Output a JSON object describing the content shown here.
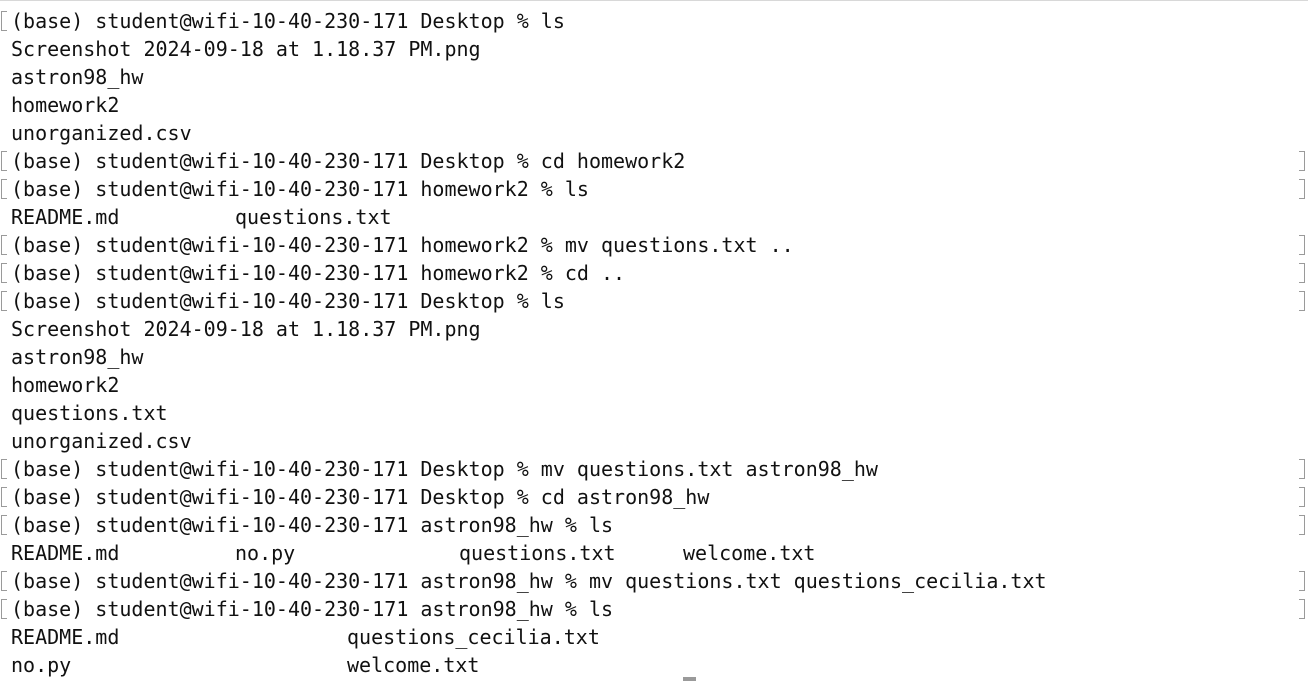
{
  "terminal": {
    "lines": [
      {
        "text": "(base) student@wifi-10-40-230-171 Desktop % ls",
        "mark": "left"
      },
      {
        "text": "Screenshot 2024-09-18 at 1.18.37 PM.png"
      },
      {
        "text": "astron98_hw"
      },
      {
        "text": "homework2"
      },
      {
        "text": "unorganized.csv"
      },
      {
        "text": "(base) student@wifi-10-40-230-171 Desktop % cd homework2",
        "mark": "both"
      },
      {
        "text": "(base) student@wifi-10-40-230-171 homework2 % ls",
        "mark": "both"
      },
      {
        "cells": [
          "README.md",
          "questions.txt"
        ],
        "cols": [
          0,
          16
        ]
      },
      {
        "text": "(base) student@wifi-10-40-230-171 homework2 % mv questions.txt ..",
        "mark": "both"
      },
      {
        "text": "(base) student@wifi-10-40-230-171 homework2 % cd ..",
        "mark": "both"
      },
      {
        "text": "(base) student@wifi-10-40-230-171 Desktop % ls",
        "mark": "both"
      },
      {
        "text": "Screenshot 2024-09-18 at 1.18.37 PM.png"
      },
      {
        "text": "astron98_hw"
      },
      {
        "text": "homework2"
      },
      {
        "text": "questions.txt"
      },
      {
        "text": "unorganized.csv"
      },
      {
        "text": "(base) student@wifi-10-40-230-171 Desktop % mv questions.txt astron98_hw",
        "mark": "both"
      },
      {
        "text": "(base) student@wifi-10-40-230-171 Desktop % cd astron98_hw",
        "mark": "both"
      },
      {
        "text": "(base) student@wifi-10-40-230-171 astron98_hw % ls",
        "mark": "both"
      },
      {
        "cells": [
          "README.md",
          "no.py",
          "questions.txt",
          "welcome.txt"
        ],
        "cols": [
          0,
          16,
          32,
          48
        ]
      },
      {
        "text": "(base) student@wifi-10-40-230-171 astron98_hw % mv questions.txt questions_cecilia.txt",
        "mark": "both"
      },
      {
        "text": "(base) student@wifi-10-40-230-171 astron98_hw % ls",
        "mark": "both"
      },
      {
        "cells": [
          "README.md",
          "questions_cecilia.txt"
        ],
        "cols": [
          0,
          24
        ]
      },
      {
        "cells": [
          "no.py",
          "welcome.txt"
        ],
        "cols": [
          0,
          24
        ]
      }
    ]
  }
}
